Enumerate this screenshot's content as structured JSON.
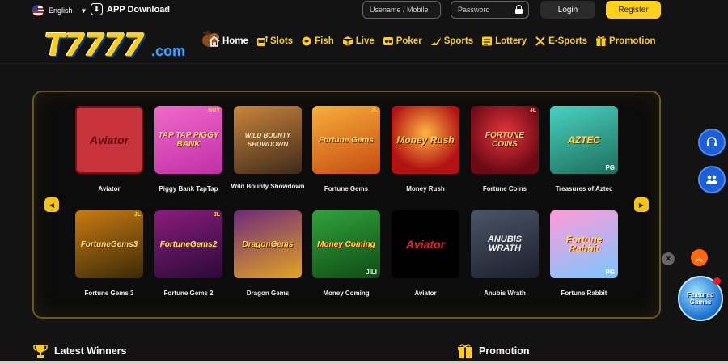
{
  "header": {
    "language": "English",
    "app_download": "APP Download",
    "username_placeholder": "Usename / Mobile",
    "password_placeholder": "Password",
    "login": "Login",
    "register": "Register"
  },
  "brand": {
    "logo_main": "T7777",
    "logo_suffix": ".com"
  },
  "nav": {
    "items": [
      {
        "label": "Home",
        "icon": "home-icon"
      },
      {
        "label": "Slots",
        "icon": "slot-machine-icon"
      },
      {
        "label": "Fish",
        "icon": "fish-icon"
      },
      {
        "label": "Live",
        "icon": "live-cube-icon"
      },
      {
        "label": "Poker",
        "icon": "poker-chip-icon"
      },
      {
        "label": "Sports",
        "icon": "sports-shoe-icon"
      },
      {
        "label": "Lottery",
        "icon": "lottery-icon"
      },
      {
        "label": "E-Sports",
        "icon": "crossed-swords-icon"
      },
      {
        "label": "Promotion",
        "icon": "gift-icon"
      }
    ]
  },
  "games": {
    "row1": [
      {
        "label": "Aviator",
        "art": "Aviator"
      },
      {
        "label": "Piggy Bank TapTap",
        "art": "TAP TAP PIGGY BANK",
        "badge": "BUY"
      },
      {
        "label": "Wild Bounty Showdown",
        "art": "WILD BOUNTY SHOWDOWN"
      },
      {
        "label": "Fortune Gems",
        "art": "Fortune Gems",
        "badge": "JL"
      },
      {
        "label": "Money Rush",
        "art": "Money Rush"
      },
      {
        "label": "Fortune Coins",
        "art": "FORTUNE COINS",
        "badge": "JL"
      },
      {
        "label": "Treasures of Aztec",
        "art": "AZTEC",
        "badge": "PG"
      }
    ],
    "row2": [
      {
        "label": "Fortune Gems 3",
        "art": "FortuneGems3",
        "badge": "JL"
      },
      {
        "label": "Fortune Gems 2",
        "art": "FortuneGems2",
        "badge": "JL"
      },
      {
        "label": "Dragon Gems",
        "art": "DragonGems"
      },
      {
        "label": "Money Coming",
        "art": "Money Coming",
        "badge": "JILI"
      },
      {
        "label": "Aviator",
        "art": "Aviator"
      },
      {
        "label": "Anubis Wrath",
        "art": "ANUBIS WRATH"
      },
      {
        "label": "Fortune Rabbit",
        "art": "Fortune Rabbit",
        "badge": "PG"
      }
    ]
  },
  "floating": {
    "featured": "Featured Games"
  },
  "sections": {
    "winners": "Latest Winners",
    "promotion": "Promotion"
  },
  "colors": {
    "accent": "#ffd11a",
    "panel_border": "#6b5b12",
    "background": "#131313"
  }
}
